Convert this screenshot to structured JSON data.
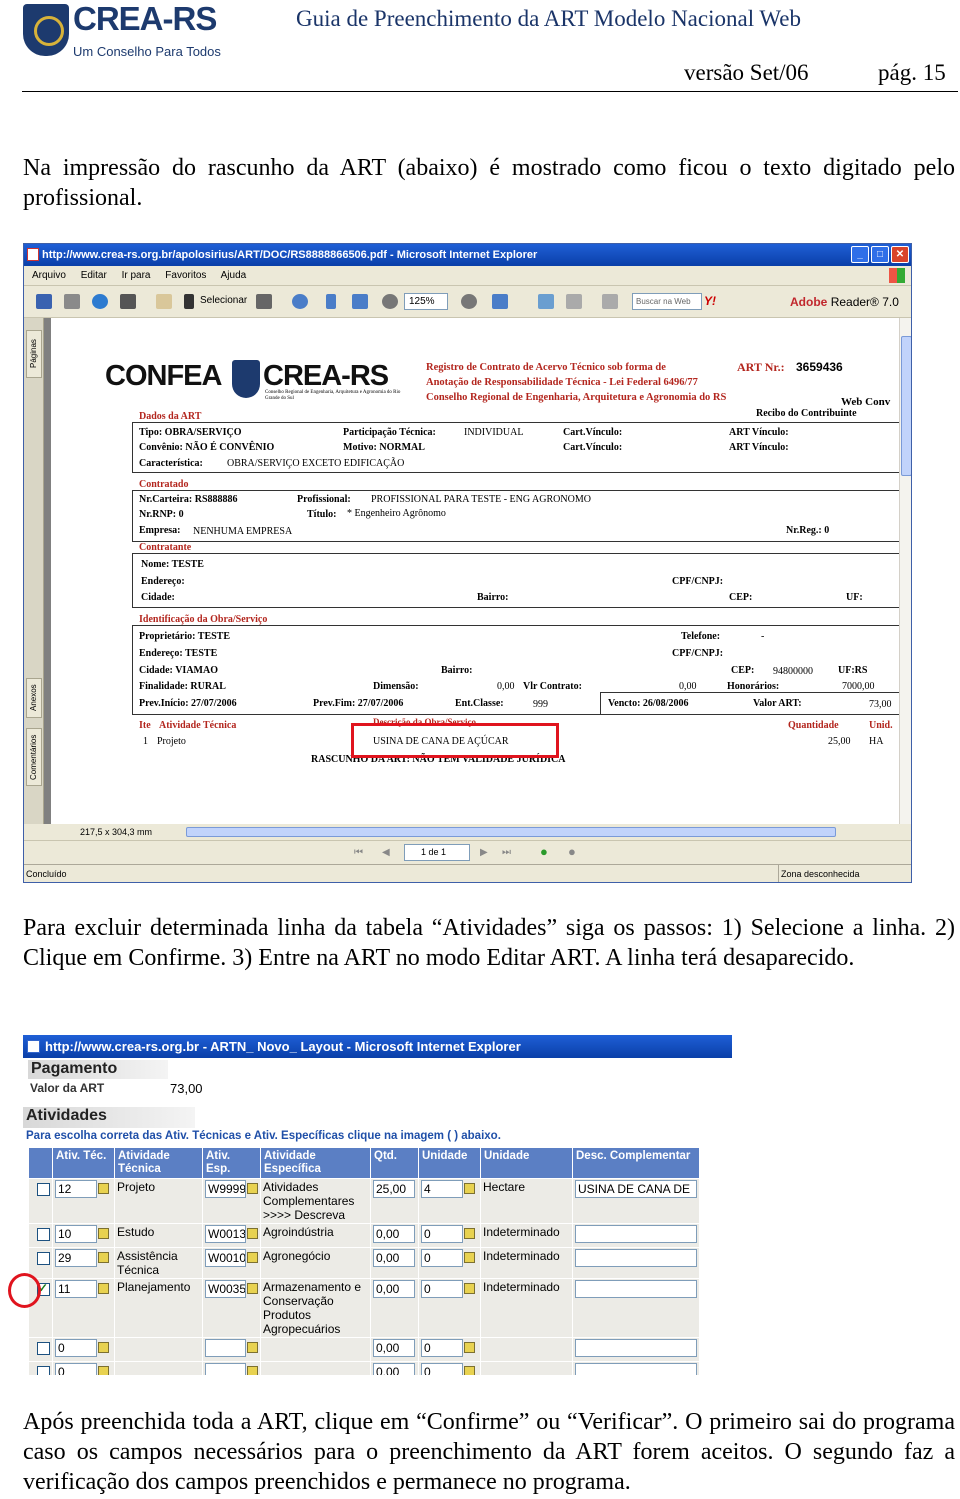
{
  "header": {
    "logo_brand": "CREA-RS",
    "logo_slogan": "Um Conselho Para Todos",
    "doc_title": "Guia de Preenchimento da ART Modelo Nacional Web",
    "version": "versão Set/06",
    "page": "pág. 15"
  },
  "paragraphs": {
    "p1": "Na impressão do rascunho da ART (abaixo) é mostrado como ficou o texto digitado pelo profissional.",
    "p2": "Para excluir determinada linha da tabela “Atividades” siga os passos: 1) Selecione a linha. 2) Clique em Confirme. 3) Entre na ART no modo Editar ART. A linha terá desaparecido.",
    "p3": "Após preenchida toda a ART, clique em “Confirme” ou “Verificar”. O primeiro sai do programa caso os campos necessários para o preenchimento da ART forem aceitos. O segundo faz a verificação dos campos preenchidos e permanece no programa."
  },
  "shot1": {
    "window_title": "http://www.crea-rs.org.br/apolosirius/ART/DOC/RS8888866506.pdf - Microsoft Internet Explorer",
    "menu": [
      "Arquivo",
      "Editar",
      "Ir para",
      "Favoritos",
      "Ajuda"
    ],
    "select_tool": "Selecionar",
    "zoom": "125%",
    "search_placeholder": "Buscar na Web",
    "yahoo": "Y!",
    "adobe_brand": "Adobe",
    "adobe_product": "Reader® 7.0",
    "side_tabs": [
      "Páginas",
      "Anexos",
      "Comentários"
    ],
    "page_size": "217,5 x 304,3 mm",
    "page_indicator": "1 de 1",
    "status_left": "Concluído",
    "status_zone": "Zona desconhecida",
    "form": {
      "confea": "CONFEA",
      "crea": "CREA-RS",
      "subtitle": "Conselho Regional de Engenharia, Arquitetura e Agronomia do Rio Grande do Sul",
      "title1": "Registro de Contrato de Acervo Técnico sob forma de",
      "title2": "Anotação de Responsabilidade Técnica - Lei Federal 6496/77",
      "title3": "Conselho Regional de Engenharia, Arquitetura e Agronomia do RS",
      "art_nr_label": "ART Nr.:",
      "art_nr": "3659436",
      "web_conv": "Web Conv",
      "recibo": "Recibo do Contribuinte",
      "sec_dados": "Dados da ART",
      "tipo": "Tipo: OBRA/SERVIÇO",
      "convenio": "Convênio:   NÃO É CONVÊNIO",
      "caracteristica_label": "Característica:",
      "caracteristica": "OBRA/SERVIÇO EXCETO EDIFICAÇÃO",
      "participacao_label": "Participação Técnica:",
      "participacao": "INDIVIDUAL",
      "motivo": "Motivo: NORMAL",
      "cart_vinculo1": "Cart.Vínculo:",
      "cart_vinculo2": "Cart.Vínculo:",
      "art_vinculo1": "ART Vínculo:",
      "art_vinculo2": "ART Vínculo:",
      "sec_contratado": "Contratado",
      "nr_carteira": "Nr.Carteira:   RS888886",
      "nr_rnp": "Nr.RNP:  0",
      "empresa_label": "Empresa:",
      "empresa": "NENHUMA EMPRESA",
      "profissional_label": "Profissional:",
      "profissional": "PROFISSIONAL PARA TESTE - ENG AGRONOMO",
      "titulo_label": "Título:",
      "titulo": "* Engenheiro Agrônomo",
      "nr_reg": "Nr.Reg.:  0",
      "sec_contratante": "Contratante",
      "nome": "Nome:   TESTE",
      "endereco": "Endereço:",
      "cidade": "Cidade:",
      "bairro": "Bairro:",
      "cpf": "CPF/CNPJ:",
      "cep": "CEP:",
      "uf": "UF:",
      "sec_ident": "Identificação da Obra/Serviço",
      "proprietario": "Proprietário:   TESTE",
      "endereco2": "Endereço:        TESTE",
      "cidade2": "Cidade:          VIAMAO",
      "finalidade": "Finalidade:   RURAL",
      "prev_inicio": "Prev.Início:   27/07/2006",
      "bairro2": "Bairro:",
      "dimensao": "Dimensão:",
      "dim_val": "0,00",
      "vlr_contrato": "Vlr Contrato:",
      "vlr_val": "0,00",
      "prev_fim": "Prev.Fim:   27/07/2006",
      "ent_classe": "Ent.Classe:",
      "ent_val": "999",
      "telefone": "Telefone:",
      "telefone_val": "-",
      "cpf2": "CPF/CNPJ:",
      "cep2": "CEP:",
      "cep2_val": "94800000",
      "uf2": "UF:RS",
      "honorarios": "Honorários:",
      "honorarios_val": "7000,00",
      "vencto": "Vencto:   26/08/2006",
      "valor_art": "Valor ART:",
      "valor_art_val": "73,00",
      "col_ite": "Ite",
      "col_atividade": "Atividade Técnica",
      "col_descricao": "Descrição da Obra/Serviço",
      "col_quantidade": "Quantidade",
      "col_unid": "Unid.",
      "row_ite": "1",
      "row_atividade": "Projeto",
      "row_descricao": "USINA DE CANA DE AÇÚCAR",
      "row_quantidade": "25,00",
      "row_unid": "HA",
      "rascunho": "RASCUNHO DA ART: NÃO TEM VALIDADE JURÍDICA"
    }
  },
  "shot2": {
    "window_title": "http://www.crea-rs.org.br - ARTN_ Novo_ Layout - Microsoft Internet Explorer",
    "pagamento": "Pagamento",
    "valor_label": "Valor da ART",
    "valor": "73,00",
    "atividades": "Atividades",
    "hint": "Para escolha correta das Ativ. Técnicas e Ativ. Específicas clique na imagem (  ) abaixo.",
    "columns": [
      "Ativ. Téc.",
      "Atividade Técnica",
      "Ativ. Esp.",
      "Atividade Específica",
      "Qtd.",
      "Unidade",
      "Unidade",
      "Desc. Complementar"
    ],
    "rows": [
      {
        "checked": false,
        "tec": "12",
        "tec_name": "Projeto",
        "esp": "W9999",
        "esp_name": "Atividades Complementares >>>> Descreva",
        "qtd": "25,00",
        "un": "4",
        "un_name": "Hectare",
        "desc": "USINA DE CANA DE"
      },
      {
        "checked": false,
        "tec": "10",
        "tec_name": "Estudo",
        "esp": "W0013",
        "esp_name": "Agroindústria",
        "qtd": "0,00",
        "un": "0",
        "un_name": "Indeterminado",
        "desc": ""
      },
      {
        "checked": false,
        "tec": "29",
        "tec_name": "Assistência Técnica",
        "esp": "W0010",
        "esp_name": "Agronegócio",
        "qtd": "0,00",
        "un": "0",
        "un_name": "Indeterminado",
        "desc": ""
      },
      {
        "checked": true,
        "tec": "11",
        "tec_name": "Planejamento",
        "esp": "W0035",
        "esp_name": "Armazenamento e Conservação Produtos Agropecuários",
        "qtd": "0,00",
        "un": "0",
        "un_name": "Indeterminado",
        "desc": ""
      },
      {
        "checked": false,
        "tec": "0",
        "tec_name": "",
        "esp": "",
        "esp_name": "",
        "qtd": "0,00",
        "un": "0",
        "un_name": "",
        "desc": ""
      },
      {
        "checked": false,
        "tec": "0",
        "tec_name": "",
        "esp": "",
        "esp_name": "",
        "qtd": "0,00",
        "un": "0",
        "un_name": "",
        "desc": ""
      }
    ]
  }
}
